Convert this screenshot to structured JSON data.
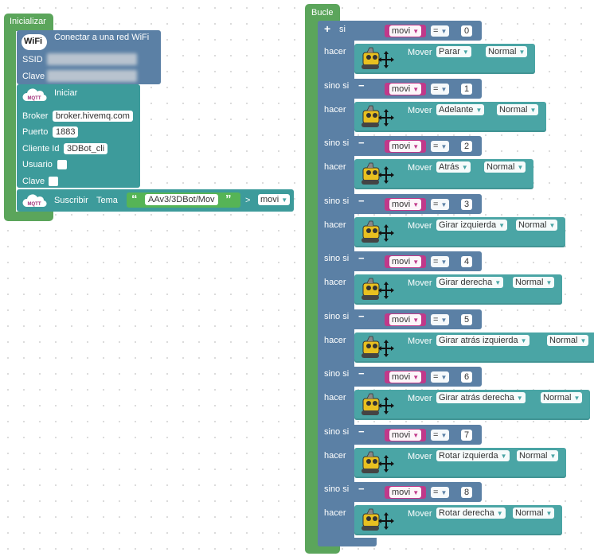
{
  "init_block": {
    "hat_label": "Inicializar",
    "wifi": {
      "icon_text": "WiFi",
      "title": "Conectar a una red WiFi",
      "ssid_label": "SSID",
      "clave_label": "Clave"
    },
    "mqtt_init": {
      "icon_text": "MQTT",
      "title": "Iniciar",
      "broker_label": "Broker",
      "broker_value": "broker.hivemq.com",
      "puerto_label": "Puerto",
      "puerto_value": "1883",
      "cliente_label": "Cliente Id",
      "cliente_value": "3DBot_cli",
      "usuario_label": "Usuario",
      "clave_label": "Clave"
    },
    "subscribe": {
      "icon_text": "MQTT",
      "label": "Suscribir",
      "tema_label": "Tema",
      "quote_open": "“",
      "quote_close": "”",
      "topic": "AAv3/3DBot/Mov",
      "arrow": ">",
      "var": "movi"
    }
  },
  "loop_block": {
    "hat_label": "Bucle",
    "plus": "+",
    "minus": "−",
    "si_label": "si",
    "sinosi_label": "sino si",
    "hacer_label": "hacer",
    "var": "movi",
    "op": "=",
    "move_label": "Mover",
    "branches": [
      {
        "value": "0",
        "direction": "Parar",
        "speed": "Normal"
      },
      {
        "value": "1",
        "direction": "Adelante",
        "speed": "Normal"
      },
      {
        "value": "2",
        "direction": "Atrás",
        "speed": "Normal"
      },
      {
        "value": "3",
        "direction": "Girar izquierda",
        "speed": "Normal"
      },
      {
        "value": "4",
        "direction": "Girar derecha",
        "speed": "Normal"
      },
      {
        "value": "5",
        "direction": "Girar atrás izquierda",
        "speed": "Normal"
      },
      {
        "value": "6",
        "direction": "Girar atrás derecha",
        "speed": "Normal"
      },
      {
        "value": "7",
        "direction": "Rotar izquierda",
        "speed": "Normal"
      },
      {
        "value": "8",
        "direction": "Rotar derecha",
        "speed": "Normal"
      }
    ]
  },
  "colors": {
    "event": "#5ba55b",
    "robot": "#3d9b9b",
    "logic": "#5b80a5",
    "variable": "#c0398a"
  }
}
